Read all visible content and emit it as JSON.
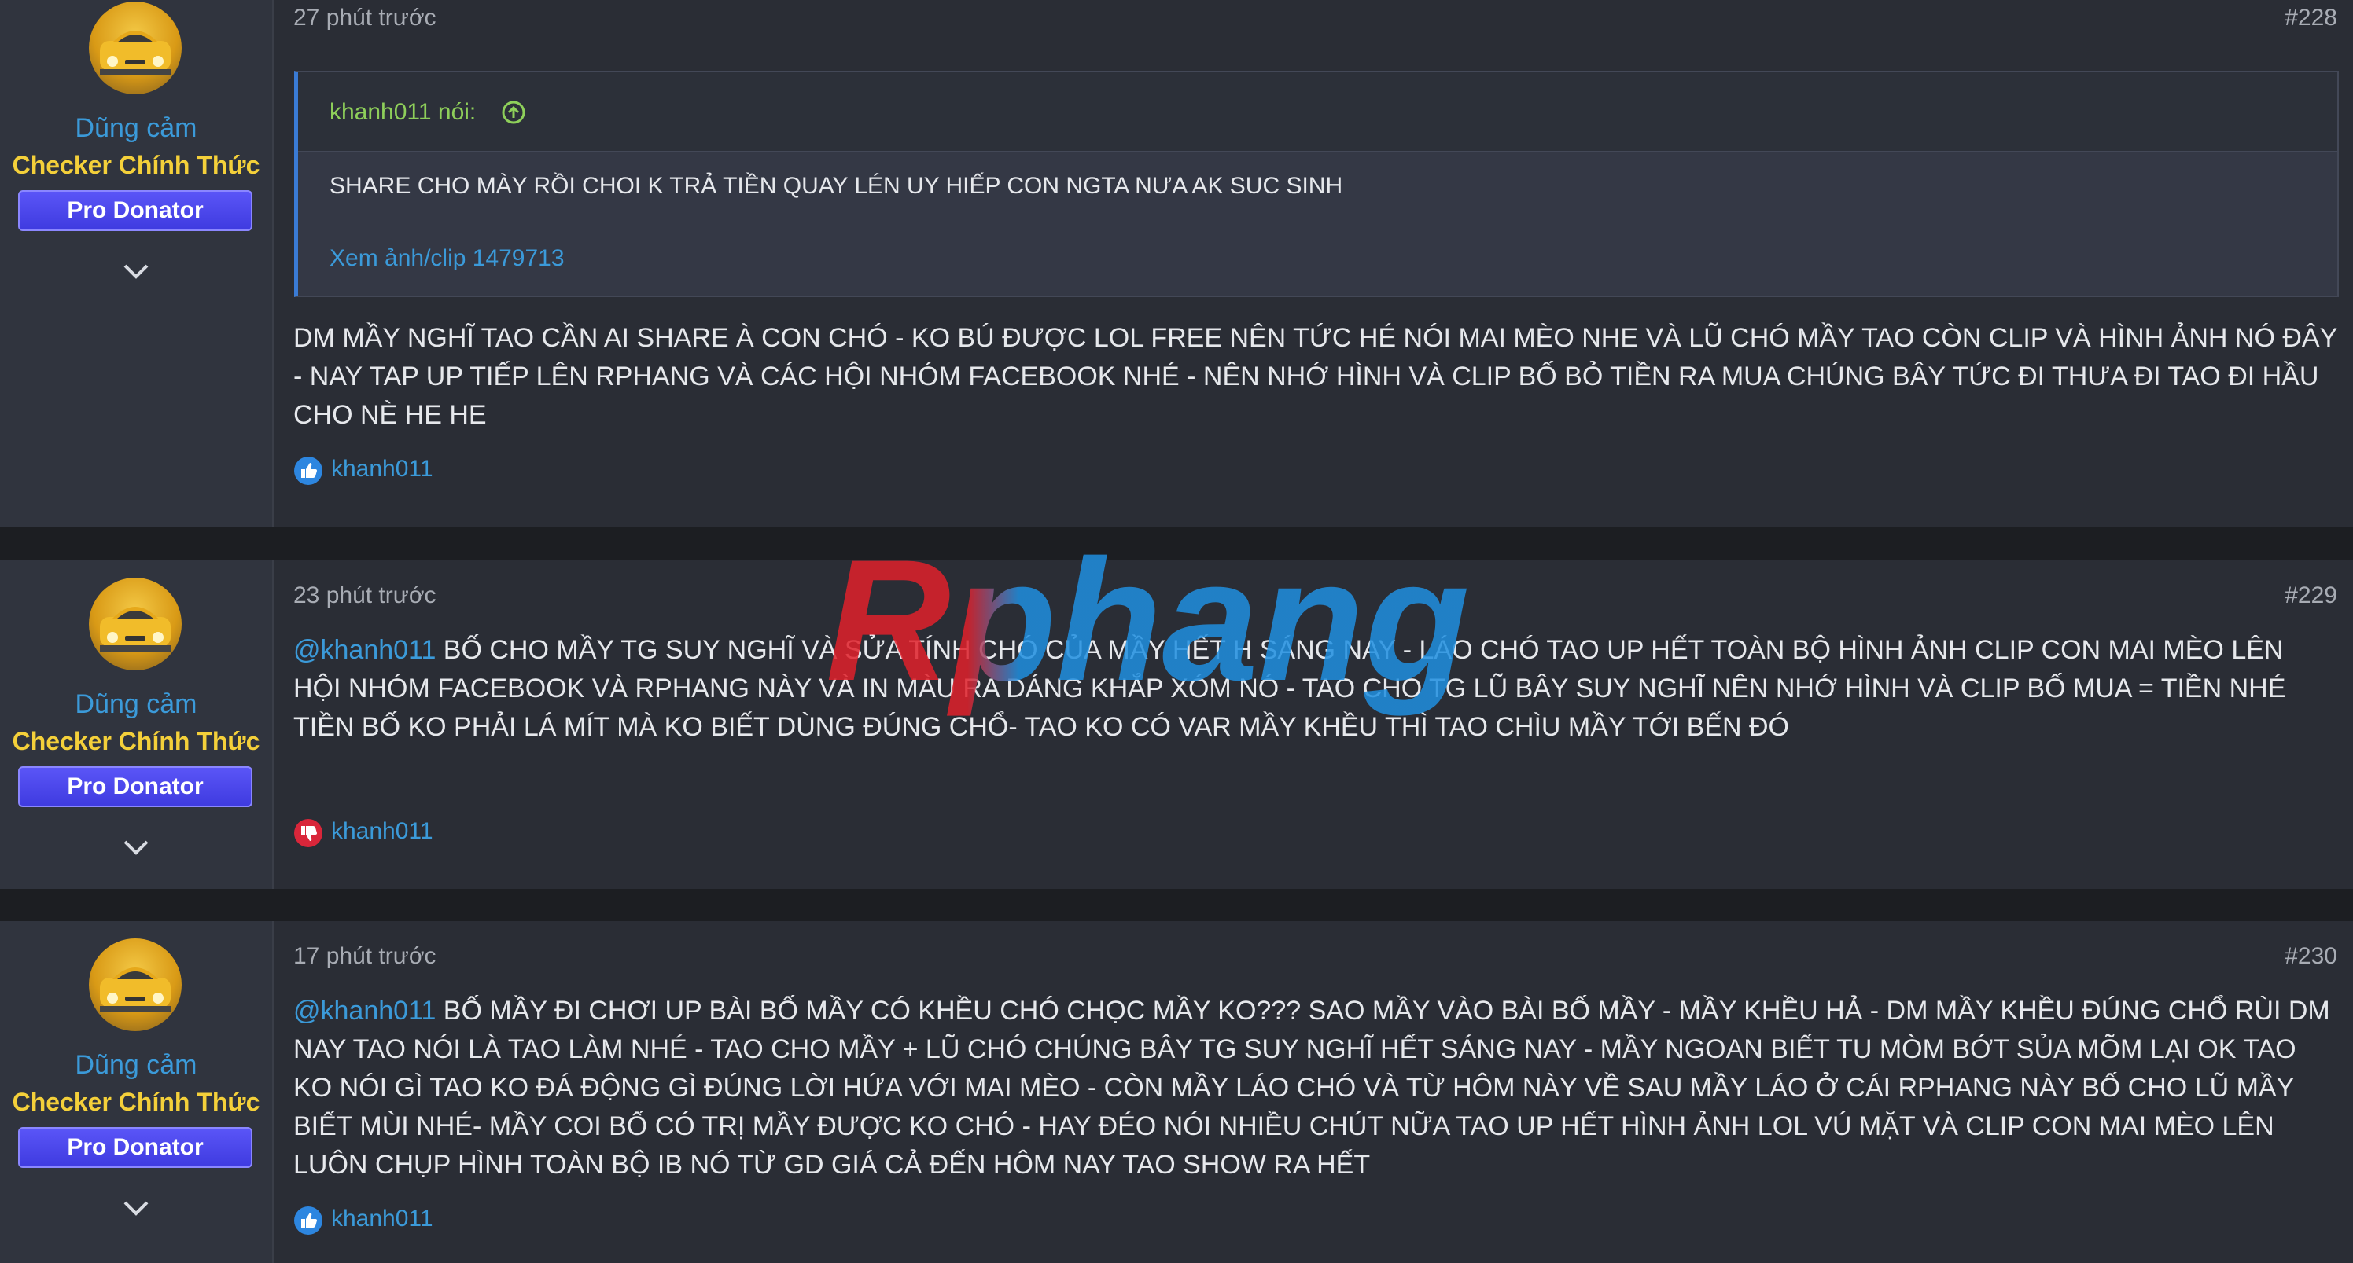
{
  "posts": [
    {
      "time": "27 phút trước",
      "number": "#228",
      "user": {
        "name": "Dũng cảm",
        "title": "Checker Chính Thức",
        "badge": "Pro Donator"
      },
      "quote": {
        "author": "khanh011 nói:",
        "text": "SHARE CHO MÀY RỒI CHOI K TRẢ TIỀN QUAY LÉN UY HIẾP CON NGTA NƯA AK SUC SINH",
        "link": "Xem ảnh/clip 1479713"
      },
      "body": "DM MẦY NGHĨ TAO CẦN AI SHARE À CON CHÓ - KO BÚ ĐƯỢC LOL FREE NÊN TỨC HÉ NÓI MAI MÈO NHE VÀ LŨ CHÓ MẦY TAO CÒN CLIP VÀ HÌNH ẢNH NÓ ĐÂY - NAY TAP UP TIẾP LÊN RPHANG VÀ CÁC HỘI NHÓM FACEBOOK NHÉ - NÊN NHỚ HÌNH VÀ CLIP BỐ BỎ TIỀN RA MUA CHÚNG BÂY TỨC ĐI THƯA ĐI TAO ĐI HẦU CHO NÈ HE HE",
      "reaction": {
        "type": "like",
        "icon": "thumbs-up-icon",
        "user": "khanh011"
      }
    },
    {
      "time": "23 phút trước",
      "number": "#229",
      "user": {
        "name": "Dũng cảm",
        "title": "Checker Chính Thức",
        "badge": "Pro Donator"
      },
      "mention": "@khanh011",
      "body": " BỐ CHO MẦY TG SUY NGHĨ VÀ SỬA TÍNH CHÓ CỦA MẦY HẾT H SÁNG NAY - LÁO CHÓ TAO UP HẾT TOÀN BỘ HÌNH ẢNH CLIP CON MAI MÈO LÊN HỘI NHÓM FACEBOOK VÀ RPHANG NÀY VÀ IN MÀU RA DÁNG KHẮP XÓM NÓ - TAO CHO TG LŨ BÂY SUY NGHĨ NÊN NHỚ HÌNH VÀ CLIP BỐ MUA = TIỀN NHÉ TIỀN BỐ KO PHẢI LÁ MÍT MÀ KO BIẾT DÙNG ĐÚNG CHỔ- TAO KO CÓ VAR MẦY KHỀU THÌ TAO CHÌU MẦY TỚI BẾN ĐÓ",
      "reaction": {
        "type": "dislike",
        "icon": "thumbs-down-icon",
        "user": "khanh011"
      }
    },
    {
      "time": "17 phút trước",
      "number": "#230",
      "user": {
        "name": "Dũng cảm",
        "title": "Checker Chính Thức",
        "badge": "Pro Donator"
      },
      "mention": "@khanh011",
      "body": " BỐ MẦY ĐI CHƠI UP BÀI BỐ MẦY CÓ KHỀU CHÓ CHỌC MẦY KO??? SAO MẦY VÀO BÀI BỐ MẦY - MẦY KHỀU HẢ - DM MẦY KHỀU ĐÚNG CHỔ RÙI DM NAY TAO NÓI LÀ TAO LÀM NHÉ - TAO CHO MẦY + LŨ CHÓ CHÚNG BÂY TG SUY NGHĨ HẾT SÁNG NAY - MẦY NGOAN BIẾT TU MÒM BỚT SỦA MÕM LẠI OK TAO KO NÓI GÌ TAO KO ĐÁ ĐỘNG GÌ ĐÚNG LỜI HỨA VỚI MAI MÈO - CÒN MẦY LÁO CHÓ VÀ TỪ HÔM NÀY VỀ SAU MẦY LÁO Ở CÁI RPHANG NÀY BỐ CHO LŨ MẦY BIẾT MÙI NHÉ- MẦY COI BỐ CÓ TRỊ MẦY ĐƯỢC KO CHÓ - HAY ĐÉO NÓI NHIỀU CHÚT NỮA TAO UP HẾT HÌNH ẢNH LOL VÚ MẶT VÀ CLIP CON MAI MÈO LÊN LUÔN CHỤP HÌNH TOÀN BỘ IB NÓ TỪ GD GIÁ CẢ ĐẾN HÔM NAY TAO SHOW RA HẾT",
      "reaction": {
        "type": "like",
        "icon": "thumbs-up-icon",
        "user": "khanh011"
      }
    }
  ],
  "watermark": {
    "text": "Rphang",
    "colors": [
      "#e0202a",
      "#1f8fe0"
    ]
  },
  "colors": {
    "page_bg": "#1c1e22",
    "post_bg": "#2a2d35",
    "sidebar_bg": "#30343e",
    "link": "#3b9ad9",
    "user_title": "#f4d03a",
    "badge": "#4a46f0",
    "quote_author": "#8ecf5a"
  }
}
